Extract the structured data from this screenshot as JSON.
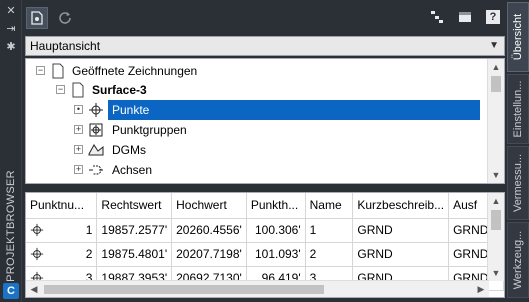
{
  "sidebar": {
    "title": "PROJEKTBROWSER",
    "app_icon": "C",
    "controls": [
      "close-icon",
      "pin-icon",
      "settings-icon"
    ]
  },
  "toolbar": {
    "icons": [
      "new-drawing-icon",
      "refresh-icon",
      "tree-view-icon",
      "layout-icon",
      "help-icon"
    ],
    "help_label": "?"
  },
  "view_select": {
    "value": "Hauptansicht"
  },
  "tree": {
    "items": [
      {
        "label": "Geöffnete Zeichnungen",
        "icon": "drawings-icon",
        "expander": "−"
      },
      {
        "label": "Surface-3",
        "icon": "drawing-icon",
        "expander": "−"
      },
      {
        "label": "Punkte",
        "icon": "points-icon",
        "expander": "•",
        "selected": true
      },
      {
        "label": "Punktgruppen",
        "icon": "point-groups-icon",
        "expander": "+"
      },
      {
        "label": "DGMs",
        "icon": "surfaces-icon",
        "expander": "+"
      },
      {
        "label": "Achsen",
        "icon": "alignments-icon",
        "expander": "+"
      }
    ]
  },
  "table": {
    "columns": [
      "Punktnu...",
      "Rechtswert",
      "Hochwert",
      "Punkth...",
      "Name",
      "Kurzbeschreib...",
      "Ausf"
    ],
    "rows": [
      [
        "1",
        "19857.2577'",
        "20260.4556'",
        "100.306'",
        "1",
        "GRND",
        "GRND"
      ],
      [
        "2",
        "19875.4801'",
        "20207.7198'",
        "101.093'",
        "2",
        "GRND",
        "GRND"
      ],
      [
        "3",
        "19887.3953'",
        "20692.7130'",
        "96.419'",
        "3",
        "GRND",
        "GRND"
      ]
    ]
  },
  "right_tabs": [
    {
      "label": "Übersicht",
      "active": true
    },
    {
      "label": "Einstellun...",
      "active": false
    },
    {
      "label": "Vermessu...",
      "active": false
    },
    {
      "label": "Werkzeug...",
      "active": false
    }
  ],
  "colors": {
    "selection": "#0a66c2",
    "panel_bg": "#2b2f36"
  }
}
